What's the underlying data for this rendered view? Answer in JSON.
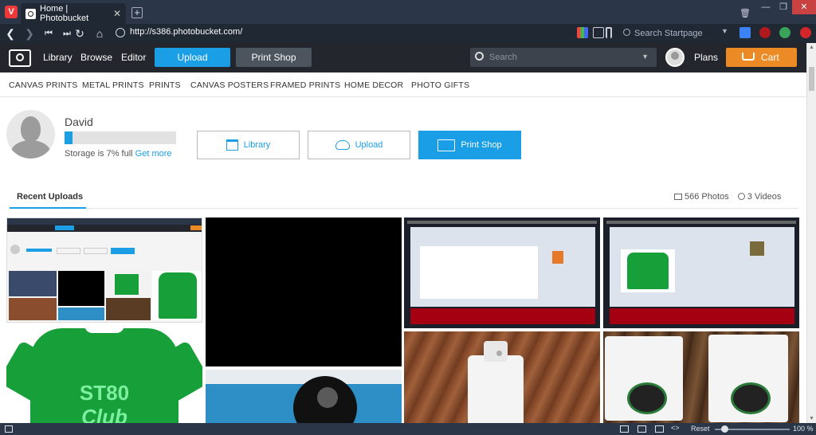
{
  "browser": {
    "tab_title": "Home | Photobucket",
    "url": "http://s386.photobucket.com/",
    "search_placeholder": "Search Startpage",
    "status": {
      "reset_label": "Reset",
      "zoom": "100 %"
    }
  },
  "header": {
    "nav": [
      "Library",
      "Browse",
      "Editor"
    ],
    "upload_label": "Upload",
    "printshop_label": "Print Shop",
    "search_placeholder": "Search",
    "plans_label": "Plans",
    "cart_label": "Cart",
    "colors": {
      "accent": "#1a9ee5",
      "cart": "#ec8a25",
      "bar": "#23272d"
    }
  },
  "subnav": [
    "CANVAS PRINTS",
    "METAL PRINTS",
    "PRINTS",
    "CANVAS POSTERS",
    "FRAMED PRINTS",
    "HOME DECOR",
    "PHOTO GIFTS"
  ],
  "profile": {
    "name": "David",
    "storage_fraction": 0.07,
    "storage_text": "Storage is 7% full",
    "get_more": "Get more"
  },
  "quick_actions": [
    {
      "label": "Library",
      "icon": "library-icon",
      "active": false
    },
    {
      "label": "Upload",
      "icon": "cloud-upload-icon",
      "active": false
    },
    {
      "label": "Print Shop",
      "icon": "print-shop-icon",
      "active": true
    }
  ],
  "recent": {
    "tab_label": "Recent Uploads",
    "photos_count": "566 Photos",
    "videos_count": "3 Videos"
  },
  "photos": {
    "shirt_line1": "ST80",
    "shirt_line2": "Club"
  }
}
